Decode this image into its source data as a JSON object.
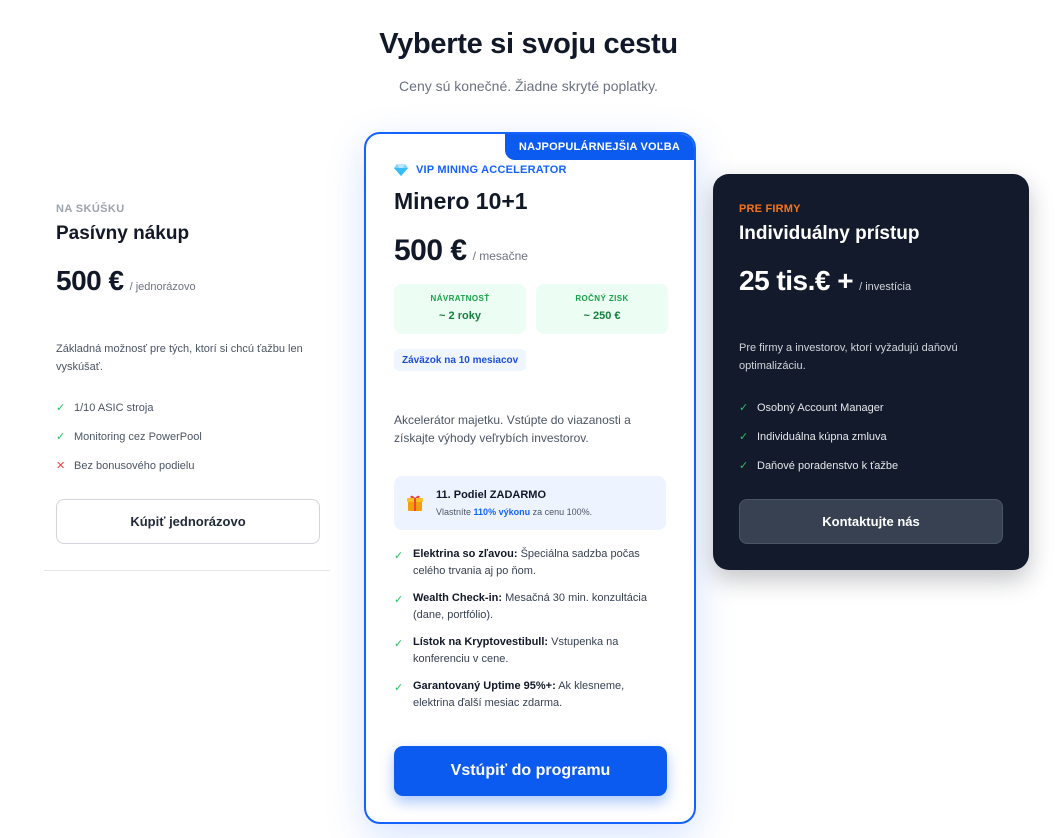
{
  "header": {
    "title": "Vyberte si svoju cestu",
    "subtitle": "Ceny sú konečné. Žiadne skryté poplatky."
  },
  "plans": {
    "basic": {
      "tag": "NA SKÚŠKU",
      "name": "Pasívny nákup",
      "price": "500 €",
      "period": "/ jednorázovo",
      "description": "Základná možnosť pre tých, ktorí si chcú ťažbu len vyskúšať.",
      "features": [
        {
          "mark": "✓",
          "text": "1/10 ASIC stroja"
        },
        {
          "mark": "✓",
          "text": "Monitoring cez PowerPool"
        },
        {
          "mark": "✕",
          "text": "Bez bonusového podielu"
        }
      ],
      "button_label": "Kúpiť jednorázovo"
    },
    "vip": {
      "ribbon": "NAJPOPULÁRNEJŠIA VOĽBA",
      "tag": "VIP MINING ACCELERATOR",
      "name": "Minero 10+1",
      "price": "500 €",
      "period": "/ mesačne",
      "stats": [
        {
          "label": "NÁVRATNOSŤ",
          "value": "~ 2 roky"
        },
        {
          "label": "ROČNÝ ZISK",
          "value": "~ 250 €"
        }
      ],
      "commitment": "Záväzok na 10 mesiacov",
      "description": "Akcelerátor majetku. Vstúpte do viazanosti a získajte výhody veľrybích investorov.",
      "bonus": {
        "title": "11. Podiel ZADARMO",
        "sub_prefix": "Vlastníte",
        "sub_highlight": "110% výkonu",
        "sub_suffix": "za cenu 100%."
      },
      "features": [
        {
          "mark": "✓",
          "title": "Elektrina so zľavou:",
          "text": "Špeciálna sadzba počas celého trvania aj po ňom."
        },
        {
          "mark": "✓",
          "title": "Wealth Check-in:",
          "text": "Mesačná 30 min. konzultácia (dane, portfólio)."
        },
        {
          "mark": "✓",
          "title": "Lístok na Kryptovestibull:",
          "text": "Vstupenka na konferenciu v cene."
        },
        {
          "mark": "✓",
          "title": "Garantovaný Uptime 95%+:",
          "text": "Ak klesneme, elektrina ďalší mesiac zdarma."
        }
      ],
      "button_label": "Vstúpiť do programu"
    },
    "business": {
      "tag": "PRE FIRMY",
      "name": "Individuálny prístup",
      "price": "25 tis.€ +",
      "period": "/ investícia",
      "description": "Pre firmy a investorov, ktorí vyžadujú daňovú optimalizáciu.",
      "features": [
        {
          "mark": "✓",
          "text": "Osobný Account Manager"
        },
        {
          "mark": "✓",
          "text": "Individuálna kúpna zmluva"
        },
        {
          "mark": "✓",
          "text": "Daňové poradenstvo k ťažbe"
        }
      ],
      "button_label": "Kontaktujte nás"
    }
  },
  "colors": {
    "accent": "#0b5bf0",
    "dark_card": "#131a2b",
    "business_tag": "#f97316",
    "success": "#22c55e",
    "danger": "#ef4444"
  },
  "icons": {
    "vip": "diamond-icon",
    "bonus": "gift-icon",
    "check": "check-icon",
    "cross": "cross-icon"
  }
}
